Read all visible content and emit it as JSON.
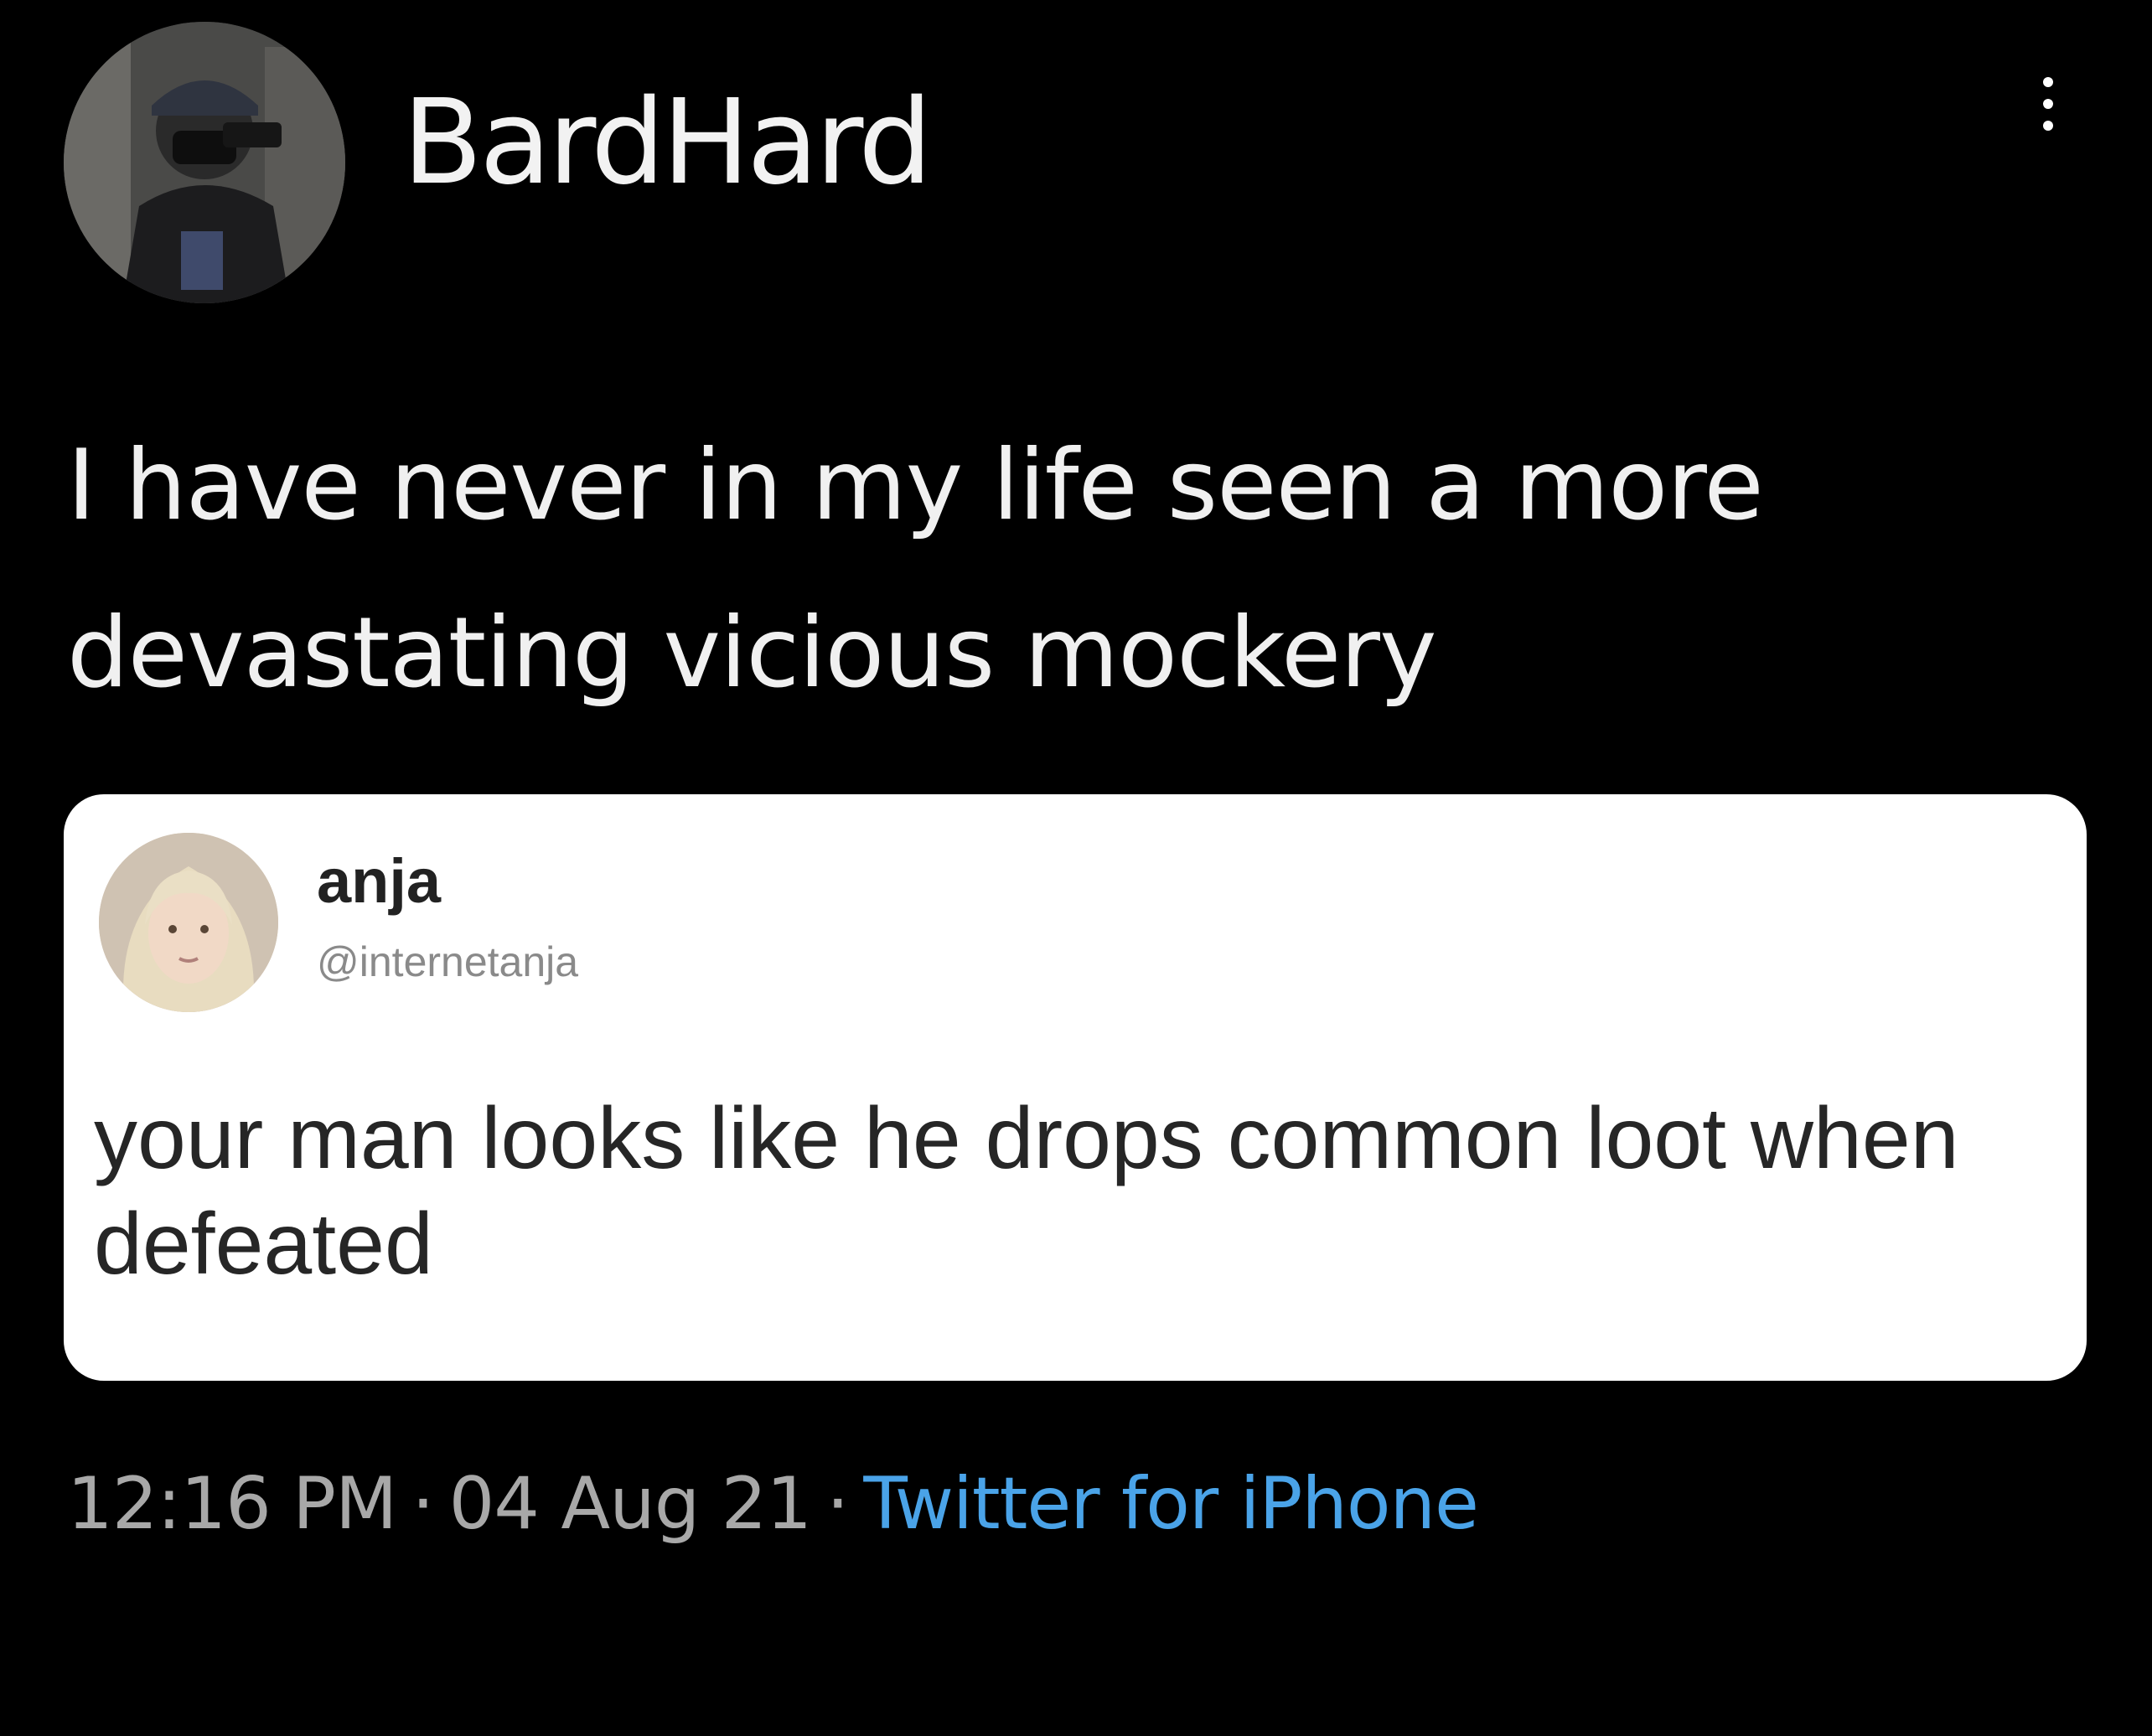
{
  "tweet": {
    "author": {
      "display_name": "BardHard",
      "avatar_icon": "user-avatar-photo"
    },
    "text": "I have never in my life seen a more devastating vicious mockery",
    "quoted_tweet": {
      "name": "anja",
      "handle": "@internetanja",
      "avatar_icon": "user-avatar-photo",
      "text": "your man looks like he drops common loot when defeated"
    },
    "meta": {
      "time": "12:16 PM",
      "date": "04 Aug 21",
      "separator": "·",
      "source": "Twitter for iPhone"
    }
  },
  "colors": {
    "background": "#000000",
    "text": "#f0f0f0",
    "meta_text": "#a8a8a8",
    "link": "#4aa3e8",
    "card": "#ffffff"
  }
}
